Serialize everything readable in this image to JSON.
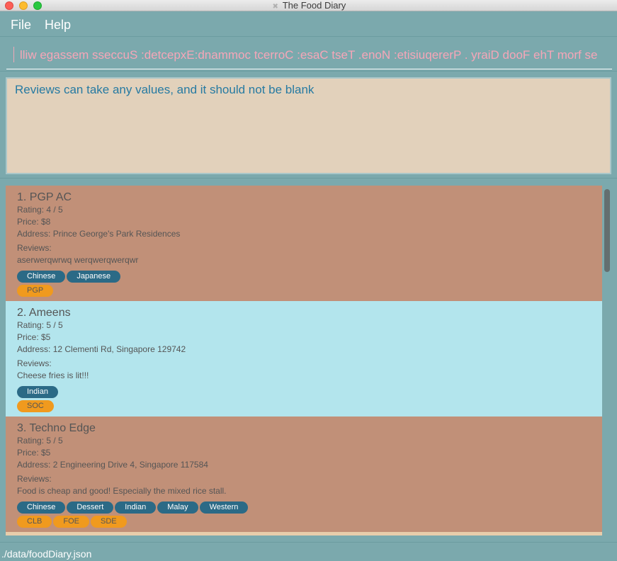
{
  "window": {
    "title": "The Food Diary",
    "icon": "app-icon"
  },
  "menu": {
    "items": [
      {
        "label": "File"
      },
      {
        "label": "Help"
      }
    ]
  },
  "command_box": {
    "value": "lliw egassem sseccuS :detcepxE:dnammoc tcerroC :esaC tseT .enoN :etisiuqererP . yraiD dooF ehT morf se"
  },
  "result_display": {
    "text": "Reviews can take any values, and it should not be blank"
  },
  "entries": [
    {
      "index_name": "1.  PGP AC",
      "rating": "Rating: 4 / 5",
      "price": "Price: $8",
      "address": "Address: Prince George's Park Residences",
      "reviews_label": "Reviews:",
      "review": "aserwerqwrwq werqwerqwerqwr",
      "categories": [
        "Chinese",
        "Japanese"
      ],
      "schools": [
        "PGP"
      ]
    },
    {
      "index_name": "2.  Ameens",
      "rating": "Rating: 5 / 5",
      "price": "Price: $5",
      "address": "Address: 12 Clementi Rd, Singapore 129742",
      "reviews_label": "Reviews:",
      "review": "Cheese fries is lit!!!",
      "categories": [
        "Indian"
      ],
      "schools": [
        "SOC"
      ]
    },
    {
      "index_name": "3.  Techno Edge",
      "rating": "Rating: 5 / 5",
      "price": "Price: $5",
      "address": "Address: 2 Engineering Drive 4, Singapore 117584",
      "reviews_label": "Reviews:",
      "review": "Food is cheap and good! Especially the mixed rice stall.",
      "categories": [
        "Chinese",
        "Dessert",
        "Indian",
        "Malay",
        "Western"
      ],
      "schools": [
        "CLB",
        "FOE",
        "SDE"
      ]
    }
  ],
  "status_bar": {
    "path": "./data/foodDiary.json"
  },
  "colors": {
    "background": "#7ba9ad",
    "card_odd": "#c19078",
    "card_even": "#b3e5ed",
    "category_tag": "#2b6a86",
    "school_tag": "#f09a1e",
    "result_bg": "#e2d1bb",
    "result_text": "#267aa2",
    "command_text": "#f6a6b8"
  }
}
